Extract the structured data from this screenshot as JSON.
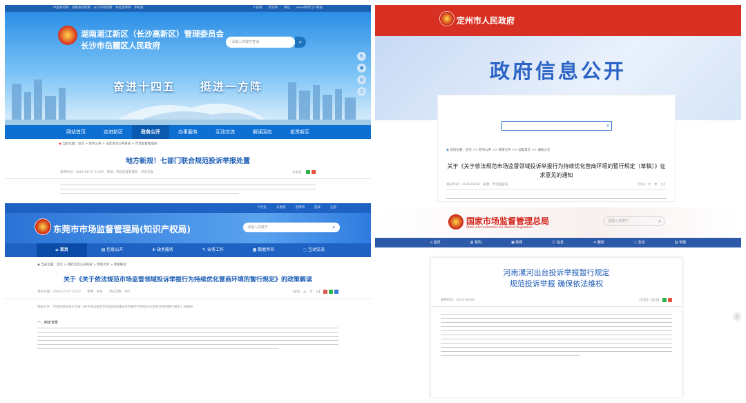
{
  "p1": {
    "topbar_left": "中国政府网　湖南省政府网　长沙市政府网　本站无障碍　手机版",
    "topbar_right": "人民网　　新浪网　　微信　　www政府门户网站",
    "title1": "湖南湘江新区（长沙高新区）管理委员会",
    "title2": "长沙市岳麓区人民政府",
    "search_placeholder": "请输入关键字查询",
    "slogan": "奋进十四五　　挺进一方阵",
    "nav": [
      "网站首页",
      "走进新区",
      "政务公开",
      "办事服务",
      "互动交流",
      "解读回应",
      "投资新区"
    ],
    "crumb": "当前位置：首页 > 政务公开 > 法定主动公开目录 > 市场监督管理局",
    "article_title": "地方新规！七部门联合规范投诉举报处置",
    "meta_left": "发布时间：2024-06-07 10:19　来源：市场监督管理局　浏览次数",
    "meta_right": "分享到："
  },
  "p2": {
    "site_name": "定州市人民政府",
    "banner": "政府信息公开",
    "crumb": "您的位置：首页 >> 政务公开 >> 政策文件 >> 征集意见 >> 通知公告",
    "article_title": "关于《关于依法规范市场监督领域投诉举报行为持续优化营商环境的暂行规定（草稿）》征求意见的通知",
    "meta_left": "发布时间：2024-08-08　来源：市场监管局",
    "meta_right": "【字号：大　中　小】"
  },
  "p3": {
    "topbar": [
      "个性化",
      "长者版",
      "无障碍",
      "登录",
      "注册"
    ],
    "site_name": "东莞市市场监督管理局(知识产权局)",
    "search_placeholder": "请输入关键字",
    "nav": [
      "首页",
      "信息公开",
      "政务服务",
      "业务工作",
      "数据专栏",
      "互动交流"
    ],
    "crumb": "当前位置：首页 > 政府信息公开目录 > 政策文件 > 政策解读",
    "article_title": "关于《关于依法规范市场监督领域投诉举报行为持续优化营商环境的暂行规定》的政策解读",
    "meta_left": "发布日期：2024-11-07 10:22　　来源：本站　　浏览次数：287",
    "meta_right": "【字体：大　中　小】",
    "ref": "相关文件：市场监管局关于印发《关于依法规范市场监督领域投诉举报行为持续优化营商环境的暂行规定》的通知",
    "section": "一、制定背景"
  },
  "p4": {
    "site_name": "国家市场监督管理总局",
    "site_en": "State Administration for Market Regulation",
    "search_placeholder": "请输入关键字",
    "nav": [
      "首页",
      "机构",
      "新闻",
      "信息",
      "服务",
      "互动",
      "专题"
    ],
    "article_title_1": "河南漯河出台投诉举报暂行规定",
    "article_title_2": "规范投诉举报 确保依法维权",
    "meta_left": "发布时间：2024-08-22",
    "meta_right": "【打印】【关闭】"
  }
}
